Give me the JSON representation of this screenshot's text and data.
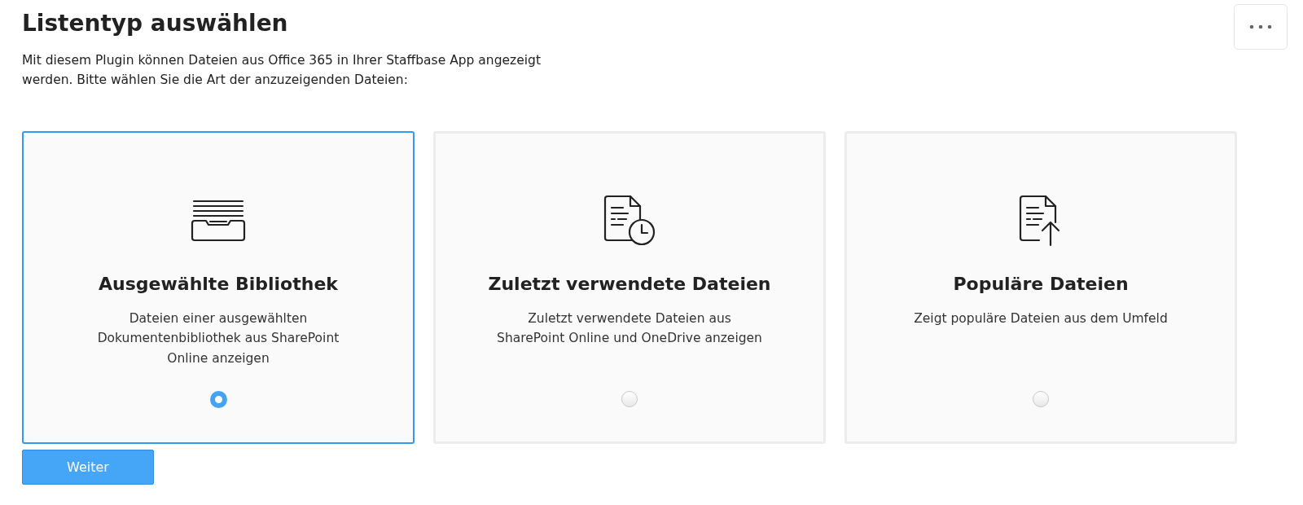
{
  "title": "Listentyp auswählen",
  "intro": "Mit diesem Plugin können Dateien aus Office 365 in Ihrer Staffbase App angezeigt werden. Bitte wählen Sie die Art der anzuzeigenden Dateien:",
  "options": [
    {
      "title": "Ausgewählte Bibliothek",
      "description": "Dateien einer ausgewählten Dokumentenbibliothek aus SharePoint Online anzeigen",
      "selected": true
    },
    {
      "title": "Zuletzt verwendete Dateien",
      "description": "Zuletzt verwendete Dateien aus SharePoint Online und OneDrive anzeigen",
      "selected": false
    },
    {
      "title": "Populäre Dateien",
      "description": "Zeigt populäre Dateien aus dem Umfeld",
      "selected": false
    }
  ],
  "button": "Weiter"
}
